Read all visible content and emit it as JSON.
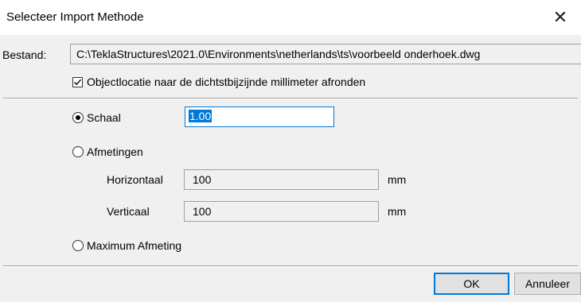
{
  "window": {
    "title": "Selecteer Import Methode",
    "close_glyph": "✕"
  },
  "file": {
    "label": "Bestand:",
    "path": "C:\\TeklaStructures\\2021.0\\Environments\\netherlands\\ts\\voorbeeld onderhoek.dwg"
  },
  "round_option": {
    "label": "Objectlocatie naar de dichtstbijzijnde millimeter afronden",
    "checked": true
  },
  "methods": {
    "scale": {
      "label": "Schaal",
      "value": "1.00",
      "selected": true
    },
    "dimensions": {
      "label": "Afmetingen",
      "selected": false,
      "horizontal_label": "Horizontaal",
      "horizontal_value": "100",
      "horizontal_unit": "mm",
      "vertical_label": "Verticaal",
      "vertical_value": "100",
      "vertical_unit": "mm"
    },
    "max_dimension": {
      "label": "Maximum Afmeting",
      "selected": false
    }
  },
  "buttons": {
    "ok": "OK",
    "cancel": "Annuleer"
  }
}
